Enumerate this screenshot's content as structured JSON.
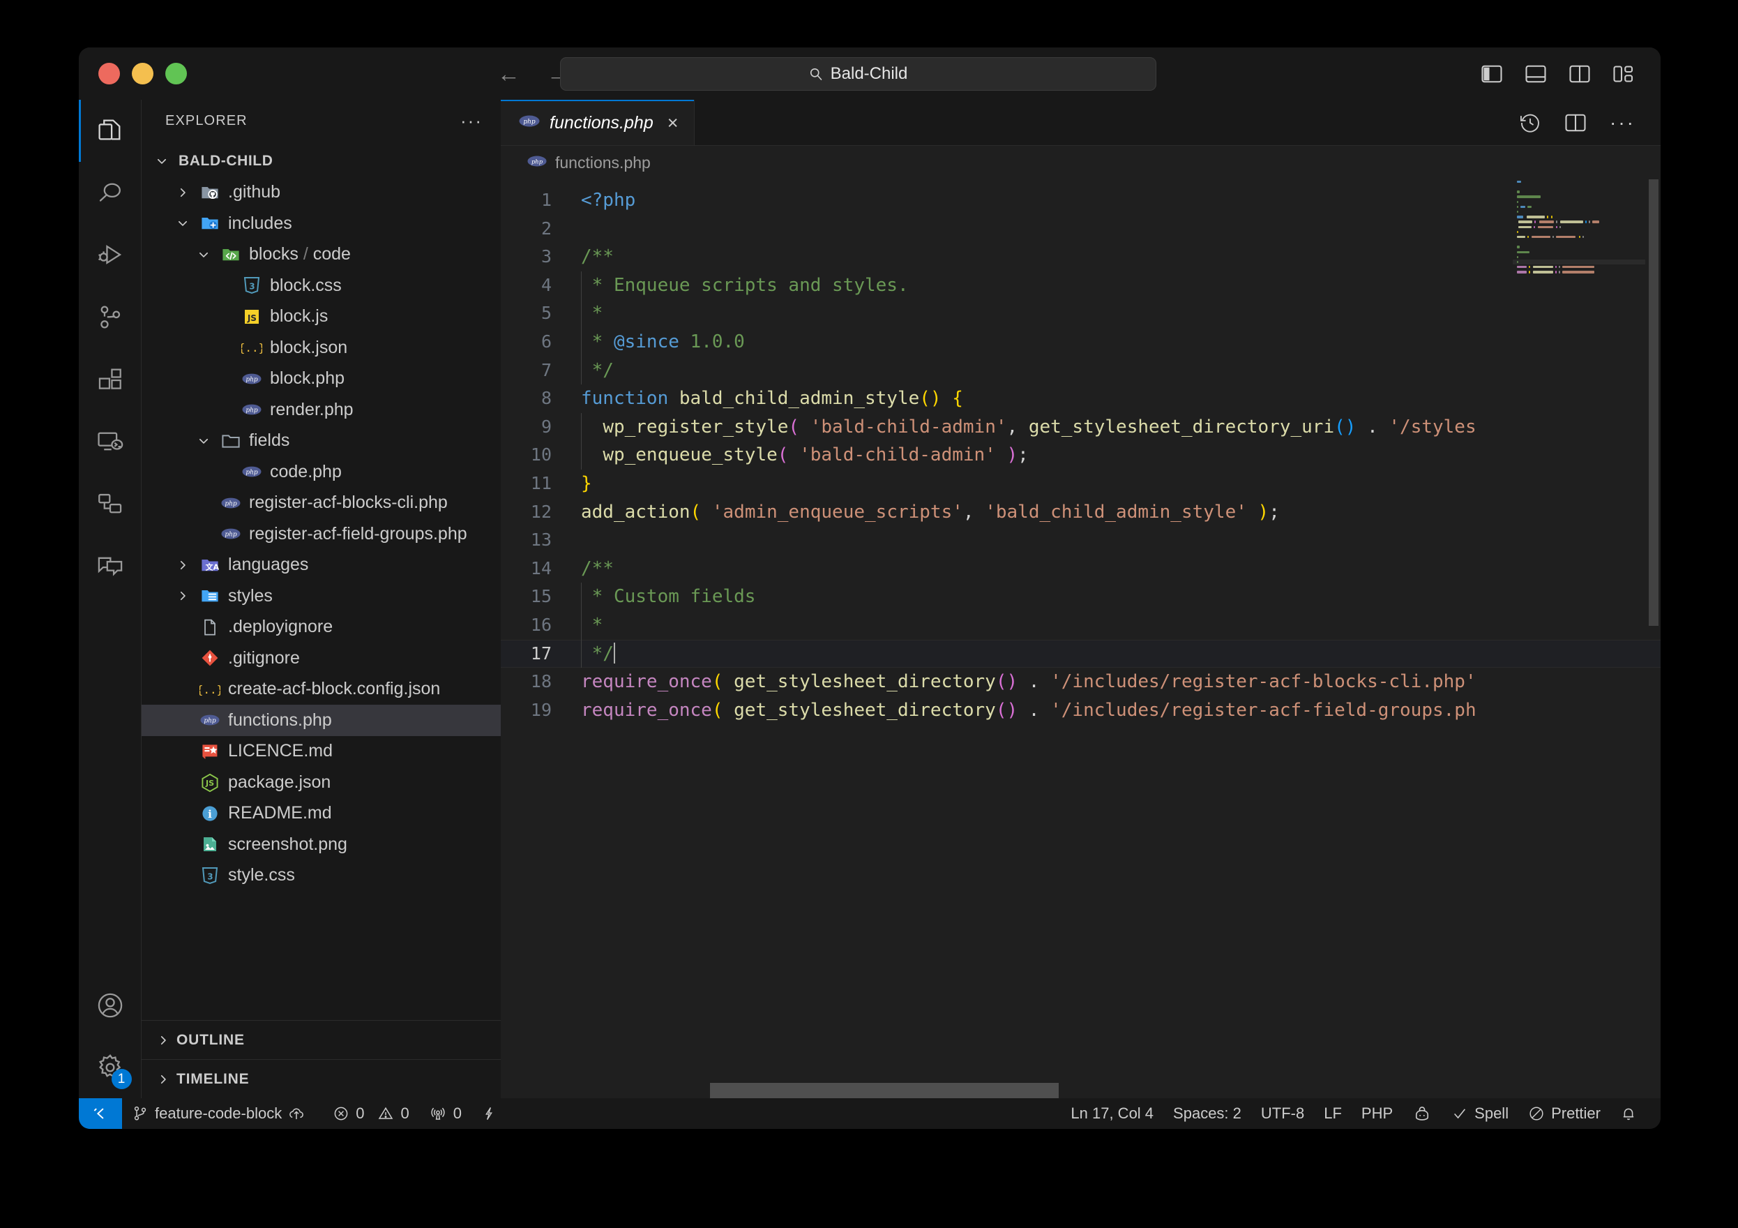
{
  "window": {
    "traffic_lights": [
      "close",
      "minimize",
      "maximize"
    ]
  },
  "titlebar": {
    "back_icon": "←",
    "forward_icon": "→",
    "search_placeholder": "Bald-Child",
    "search_value": "Bald-Child",
    "search_icon": "search-icon",
    "layout_icons": [
      "toggle-primary-sidebar",
      "toggle-panel",
      "toggle-secondary-sidebar",
      "customize-layout"
    ]
  },
  "activitybar": {
    "items": [
      {
        "name": "explorer",
        "label": "Explorer",
        "active": true
      },
      {
        "name": "search",
        "label": "Search",
        "active": false
      },
      {
        "name": "run-and-debug",
        "label": "Run and Debug",
        "active": false
      },
      {
        "name": "source-control",
        "label": "Source Control",
        "active": false
      },
      {
        "name": "extensions",
        "label": "Extensions",
        "active": false
      },
      {
        "name": "remote-explorer",
        "label": "Remote Explorer",
        "active": false
      },
      {
        "name": "testing",
        "label": "Testing",
        "active": false
      },
      {
        "name": "chat",
        "label": "Chat",
        "active": false
      }
    ],
    "bottom": [
      {
        "name": "accounts",
        "label": "Accounts",
        "badge": ""
      },
      {
        "name": "settings",
        "label": "Manage",
        "badge": "1"
      }
    ]
  },
  "sidebar": {
    "title": "EXPLORER",
    "more_actions": "···",
    "root": {
      "label": "BALD-CHILD",
      "expanded": true
    },
    "tree": [
      {
        "label": ".github",
        "icon": "github-folder-icon",
        "kind": "folder",
        "indent": 1,
        "expanded": false
      },
      {
        "label": "includes",
        "icon": "includes-folder-icon",
        "kind": "folder",
        "indent": 1,
        "expanded": true
      },
      {
        "label": "blocks / code",
        "icon": "code-folder-icon",
        "kind": "folder",
        "indent": 2,
        "expanded": true
      },
      {
        "label": "block.css",
        "icon": "css-icon",
        "kind": "file",
        "indent": 3
      },
      {
        "label": "block.js",
        "icon": "js-icon",
        "kind": "file",
        "indent": 3
      },
      {
        "label": "block.json",
        "icon": "json-icon",
        "kind": "file",
        "indent": 3
      },
      {
        "label": "block.php",
        "icon": "php-icon",
        "kind": "file",
        "indent": 3
      },
      {
        "label": "render.php",
        "icon": "php-icon",
        "kind": "file",
        "indent": 3
      },
      {
        "label": "fields",
        "icon": "folder-icon",
        "kind": "folder",
        "indent": 2,
        "expanded": true
      },
      {
        "label": "code.php",
        "icon": "php-icon",
        "kind": "file",
        "indent": 3
      },
      {
        "label": "register-acf-blocks-cli.php",
        "icon": "php-icon",
        "kind": "file",
        "indent": 2
      },
      {
        "label": "register-acf-field-groups.php",
        "icon": "php-icon",
        "kind": "file",
        "indent": 2
      },
      {
        "label": "languages",
        "icon": "languages-folder-icon",
        "kind": "folder",
        "indent": 1,
        "expanded": false
      },
      {
        "label": "styles",
        "icon": "styles-folder-icon",
        "kind": "folder",
        "indent": 1,
        "expanded": false
      },
      {
        "label": ".deployignore",
        "icon": "file-icon",
        "kind": "file",
        "indent": 1
      },
      {
        "label": ".gitignore",
        "icon": "git-icon",
        "kind": "file",
        "indent": 1
      },
      {
        "label": "create-acf-block.config.json",
        "icon": "json-icon",
        "kind": "file",
        "indent": 1
      },
      {
        "label": "functions.php",
        "icon": "php-icon",
        "kind": "file",
        "indent": 1,
        "selected": true
      },
      {
        "label": "LICENCE.md",
        "icon": "licence-icon",
        "kind": "file",
        "indent": 1
      },
      {
        "label": "package.json",
        "icon": "nodejs-icon",
        "kind": "file",
        "indent": 1
      },
      {
        "label": "README.md",
        "icon": "readme-icon",
        "kind": "file",
        "indent": 1
      },
      {
        "label": "screenshot.png",
        "icon": "image-icon",
        "kind": "file",
        "indent": 1
      },
      {
        "label": "style.css",
        "icon": "css-icon",
        "kind": "file",
        "indent": 1
      }
    ],
    "panels": [
      {
        "label": "OUTLINE",
        "expanded": false
      },
      {
        "label": "TIMELINE",
        "expanded": false
      }
    ]
  },
  "editor": {
    "tabs": [
      {
        "label": "functions.php",
        "icon": "php-icon",
        "active": true,
        "preview": true,
        "close_icon": "×"
      }
    ],
    "tab_actions": [
      "timeline-history-icon",
      "split-editor-icon",
      "more-actions-icon"
    ],
    "breadcrumb": {
      "icon": "php-icon",
      "label": "functions.php"
    },
    "cursor_line": 17,
    "lines": [
      {
        "n": 1,
        "tokens": [
          {
            "t": "<?php",
            "c": "k"
          }
        ]
      },
      {
        "n": 2,
        "tokens": []
      },
      {
        "n": 3,
        "tokens": [
          {
            "t": "/**",
            "c": "cmt"
          }
        ]
      },
      {
        "n": 4,
        "tokens": [
          {
            "t": " * Enqueue scripts and styles.",
            "c": "cmt"
          }
        ],
        "guide": true
      },
      {
        "n": 5,
        "tokens": [
          {
            "t": " *",
            "c": "cmt"
          }
        ],
        "guide": true
      },
      {
        "n": 6,
        "tokens": [
          {
            "t": " * ",
            "c": "cmt"
          },
          {
            "t": "@since",
            "c": "tag"
          },
          {
            "t": " 1.0.0",
            "c": "cmt"
          }
        ],
        "guide": true
      },
      {
        "n": 7,
        "tokens": [
          {
            "t": " */",
            "c": "cmt"
          }
        ],
        "guide": true
      },
      {
        "n": 8,
        "tokens": [
          {
            "t": "function",
            "c": "k"
          },
          {
            "t": " ",
            "c": "pl"
          },
          {
            "t": "bald_child_admin_style",
            "c": "fn"
          },
          {
            "t": "()",
            "c": "p1"
          },
          {
            "t": " ",
            "c": "pl"
          },
          {
            "t": "{",
            "c": "p1"
          }
        ]
      },
      {
        "n": 9,
        "tokens": [
          {
            "t": "  ",
            "c": "pl"
          },
          {
            "t": "wp_register_style",
            "c": "fn"
          },
          {
            "t": "(",
            "c": "p2"
          },
          {
            "t": " ",
            "c": "pl"
          },
          {
            "t": "'bald-child-admin'",
            "c": "str"
          },
          {
            "t": ",",
            "c": "pl"
          },
          {
            "t": " ",
            "c": "pl"
          },
          {
            "t": "get_stylesheet_directory_uri",
            "c": "fn"
          },
          {
            "t": "()",
            "c": "p3"
          },
          {
            "t": " . ",
            "c": "pl"
          },
          {
            "t": "'/styles",
            "c": "str"
          }
        ],
        "guide": true
      },
      {
        "n": 10,
        "tokens": [
          {
            "t": "  ",
            "c": "pl"
          },
          {
            "t": "wp_enqueue_style",
            "c": "fn"
          },
          {
            "t": "(",
            "c": "p2"
          },
          {
            "t": " ",
            "c": "pl"
          },
          {
            "t": "'bald-child-admin'",
            "c": "str"
          },
          {
            "t": " ",
            "c": "pl"
          },
          {
            "t": ")",
            "c": "p2"
          },
          {
            "t": ";",
            "c": "pl"
          }
        ],
        "guide": true
      },
      {
        "n": 11,
        "tokens": [
          {
            "t": "}",
            "c": "p1"
          }
        ]
      },
      {
        "n": 12,
        "tokens": [
          {
            "t": "add_action",
            "c": "fn"
          },
          {
            "t": "(",
            "c": "p1"
          },
          {
            "t": " ",
            "c": "pl"
          },
          {
            "t": "'admin_enqueue_scripts'",
            "c": "str"
          },
          {
            "t": ", ",
            "c": "pl"
          },
          {
            "t": "'bald_child_admin_style'",
            "c": "str"
          },
          {
            "t": " ",
            "c": "pl"
          },
          {
            "t": ")",
            "c": "p1"
          },
          {
            "t": ";",
            "c": "pl"
          }
        ]
      },
      {
        "n": 13,
        "tokens": []
      },
      {
        "n": 14,
        "tokens": [
          {
            "t": "/**",
            "c": "cmt"
          }
        ]
      },
      {
        "n": 15,
        "tokens": [
          {
            "t": " * Custom fields",
            "c": "cmt"
          }
        ],
        "guide": true
      },
      {
        "n": 16,
        "tokens": [
          {
            "t": " *",
            "c": "cmt"
          }
        ],
        "guide": true
      },
      {
        "n": 17,
        "tokens": [
          {
            "t": " */",
            "c": "cmt"
          }
        ],
        "guide": true,
        "active": true,
        "cursor": true
      },
      {
        "n": 18,
        "tokens": [
          {
            "t": "require_once",
            "c": "kw2"
          },
          {
            "t": "(",
            "c": "p1"
          },
          {
            "t": " ",
            "c": "pl"
          },
          {
            "t": "get_stylesheet_directory",
            "c": "fn"
          },
          {
            "t": "()",
            "c": "p2"
          },
          {
            "t": " . ",
            "c": "pl"
          },
          {
            "t": "'/includes/register-acf-blocks-cli.php'",
            "c": "str"
          }
        ]
      },
      {
        "n": 19,
        "tokens": [
          {
            "t": "require_once",
            "c": "kw2"
          },
          {
            "t": "(",
            "c": "p1"
          },
          {
            "t": " ",
            "c": "pl"
          },
          {
            "t": "get_stylesheet_directory",
            "c": "fn"
          },
          {
            "t": "()",
            "c": "p2"
          },
          {
            "t": " . ",
            "c": "pl"
          },
          {
            "t": "'/includes/register-acf-field-groups.ph",
            "c": "str"
          }
        ]
      }
    ]
  },
  "statusbar": {
    "remote_icon": "remote-window-icon",
    "branch_icon": "source-control-branch-icon",
    "branch": "feature-code-block",
    "sync_icon": "cloud-upload-icon",
    "errors_icon": "error-icon",
    "errors": "0",
    "warnings_icon": "warning-icon",
    "warnings": "0",
    "ports_icon": "radio-tower-icon",
    "ports": "0",
    "lightning_icon": "zap-icon",
    "cursor_position": "Ln 17, Col 4",
    "indentation": "Spaces: 2",
    "encoding": "UTF-8",
    "eol": "LF",
    "language": "PHP",
    "copilot_icon": "copilot-icon",
    "spell_icon": "check-icon",
    "spell": "Spell",
    "prettier_icon": "prettier-icon",
    "prettier": "Prettier",
    "bell_icon": "bell-icon"
  }
}
